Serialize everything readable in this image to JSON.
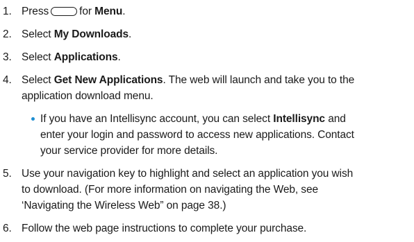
{
  "steps": [
    {
      "number": "1.",
      "before": "Press",
      "icon": "menu-key-icon",
      "middle": "for",
      "bold": "Menu",
      "after": "."
    },
    {
      "number": "2.",
      "before": "Select",
      "bold": "My Downloads",
      "after": "."
    },
    {
      "number": "3.",
      "before": "Select",
      "bold": "Applications",
      "after": "."
    },
    {
      "number": "4.",
      "before": "Select",
      "bold": "Get New Applications",
      "after": ". The web will launch and take you to the",
      "line2": "application download menu."
    },
    {
      "number": "5.",
      "line1": "Use your navigation key to highlight and select an application you wish",
      "line2": "to download. (For more information on navigating the Web, see",
      "line3": "‘Navigating the Wireless Web” on page 38.)"
    },
    {
      "number": "6.",
      "line1": "Follow the web page instructions to complete your purchase."
    }
  ],
  "bullet": {
    "before": "If you have an Intellisync account, you can select",
    "bold": "Intellisync",
    "after": "and",
    "line2": "enter your login and password to access new applications. Contact",
    "line3": "your service provider for more details."
  },
  "colors": {
    "bullet": "#1e8ed1",
    "text": "#1a1a1a"
  }
}
